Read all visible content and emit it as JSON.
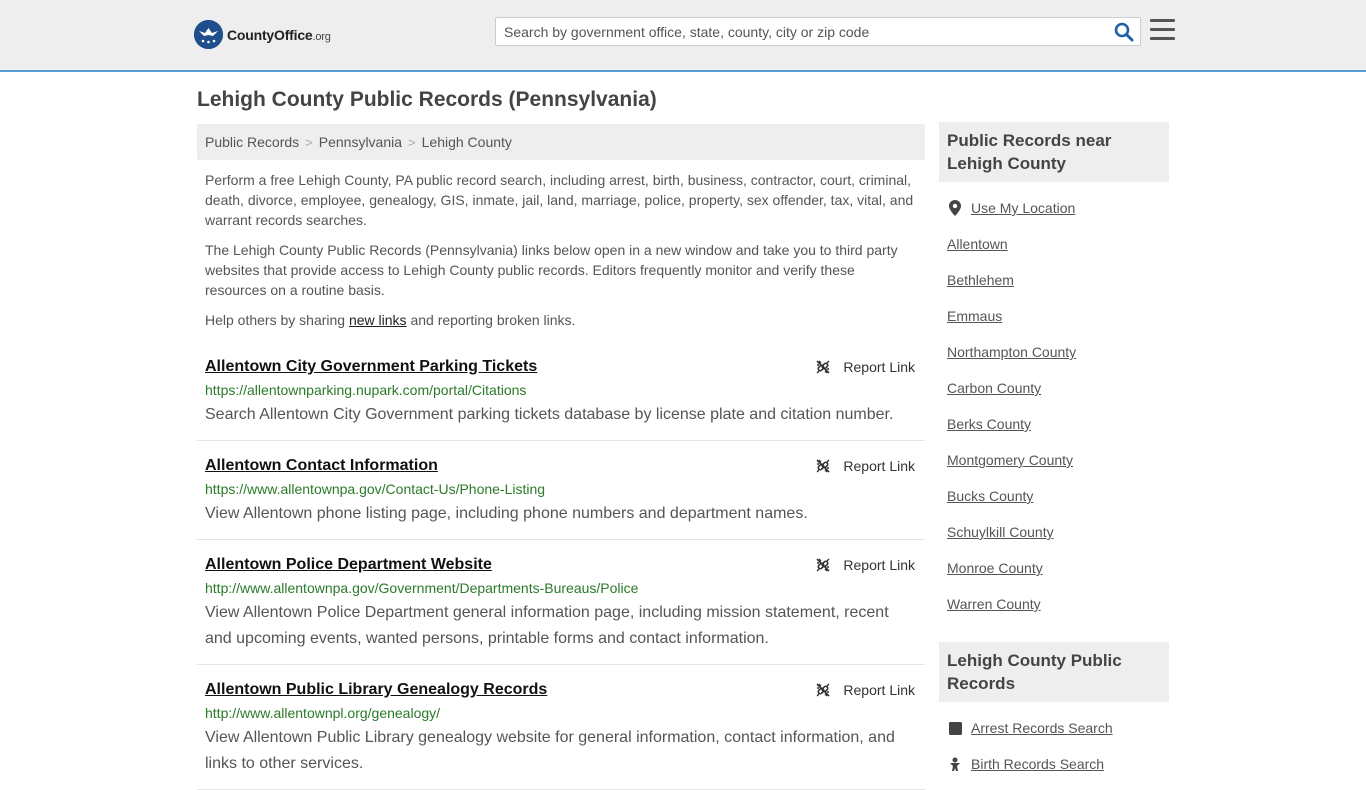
{
  "header": {
    "logo_text_main": "CountyOffice",
    "logo_text_suffix": ".org",
    "search_placeholder": "Search by government office, state, county, city or zip code"
  },
  "page": {
    "title": "Lehigh County Public Records (Pennsylvania)"
  },
  "breadcrumb": [
    "Public Records",
    "Pennsylvania",
    "Lehigh County"
  ],
  "intro": {
    "p1": "Perform a free Lehigh County, PA public record search, including arrest, birth, business, contractor, court, criminal, death, divorce, employee, genealogy, GIS, inmate, jail, land, marriage, police, property, sex offender, tax, vital, and warrant records searches.",
    "p2": "The Lehigh County Public Records (Pennsylvania) links below open in a new window and take you to third party websites that provide access to Lehigh County public records. Editors frequently monitor and verify these resources on a routine basis.",
    "p3_before": "Help others by sharing ",
    "p3_link": "new links",
    "p3_after": " and reporting broken links."
  },
  "report_label": "Report Link",
  "results": [
    {
      "title": "Allentown City Government Parking Tickets",
      "url": "https://allentownparking.nupark.com/portal/Citations",
      "desc": "Search Allentown City Government parking tickets database by license plate and citation number."
    },
    {
      "title": "Allentown Contact Information",
      "url": "https://www.allentownpa.gov/Contact-Us/Phone-Listing",
      "desc": "View Allentown phone listing page, including phone numbers and department names."
    },
    {
      "title": "Allentown Police Department Website",
      "url": "http://www.allentownpa.gov/Government/Departments-Bureaus/Police",
      "desc": "View Allentown Police Department general information page, including mission statement, recent and upcoming events, wanted persons, printable forms and contact information."
    },
    {
      "title": "Allentown Public Library Genealogy Records",
      "url": "http://www.allentownpl.org/genealogy/",
      "desc": "View Allentown Public Library genealogy website for general information, contact information, and links to other services."
    }
  ],
  "sidebar": {
    "nearby_heading": "Public Records near Lehigh County",
    "use_location": "Use My Location",
    "nearby": [
      "Allentown",
      "Bethlehem",
      "Emmaus",
      "Northampton County",
      "Carbon County",
      "Berks County",
      "Montgomery County",
      "Bucks County",
      "Schuylkill County",
      "Monroe County",
      "Warren County"
    ],
    "records_heading": "Lehigh County Public Records",
    "records": [
      "Arrest Records Search",
      "Birth Records Search"
    ]
  },
  "colors": {
    "accent": "#5b9bd5",
    "url_green": "#2a7a2a",
    "logo_blue": "#1f4e8c"
  }
}
